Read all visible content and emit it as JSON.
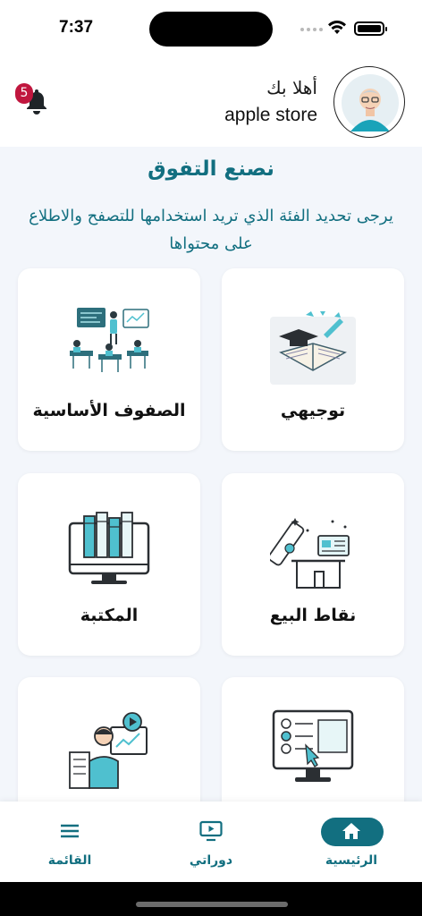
{
  "status": {
    "time": "7:37"
  },
  "header": {
    "greeting": "أهلا بك",
    "store_name": "apple store",
    "notifications_count": "5"
  },
  "intro": {
    "headline": "نصنع التفوق",
    "subtitle": "يرجى تحديد الفئة الذي تريد استخدامها للتصفح والاطلاع على محتواها"
  },
  "categories": [
    {
      "label": "توجيهي",
      "icon": "graduation-book-icon"
    },
    {
      "label": "الصفوف الأساسية",
      "icon": "classroom-icon"
    },
    {
      "label": "نقاط البيع",
      "icon": "store-diploma-icon"
    },
    {
      "label": "المكتبة",
      "icon": "library-monitor-icon"
    },
    {
      "label": "",
      "icon": "online-test-icon"
    },
    {
      "label": "",
      "icon": "teacher-video-icon"
    }
  ],
  "nav": {
    "home": "الرئيسية",
    "courses": "دوراتي",
    "menu": "القائمة"
  },
  "colors": {
    "primary": "#126f80",
    "badge": "#c0163e",
    "background": "#f3f6fb"
  }
}
